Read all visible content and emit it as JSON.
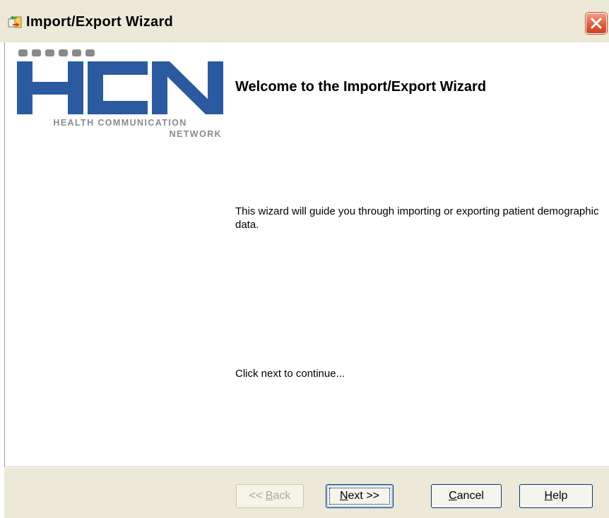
{
  "window": {
    "title": "Import/Export Wizard",
    "icon": "import-export-app-icon",
    "close_icon": "close-icon",
    "close_color": "#e0603e"
  },
  "logo": {
    "letters": "HCN",
    "line1": "HEALTH COMMUNICATION",
    "line2": "NETWORK",
    "brand_color": "#2b5aa0",
    "dots_color": "#8a8a8a"
  },
  "content": {
    "welcome": "Welcome to the Import/Export Wizard",
    "description": "This wizard will guide you through importing or exporting patient demographic data.",
    "continue_hint": "Click next to continue..."
  },
  "buttons": {
    "back": {
      "pre": "<< ",
      "mnemonic": "B",
      "rest": "ack"
    },
    "next": {
      "mnemonic": "N",
      "rest": "ext >>"
    },
    "cancel": {
      "mnemonic": "C",
      "rest": "ancel"
    },
    "help": {
      "mnemonic": "H",
      "rest": "elp"
    }
  }
}
